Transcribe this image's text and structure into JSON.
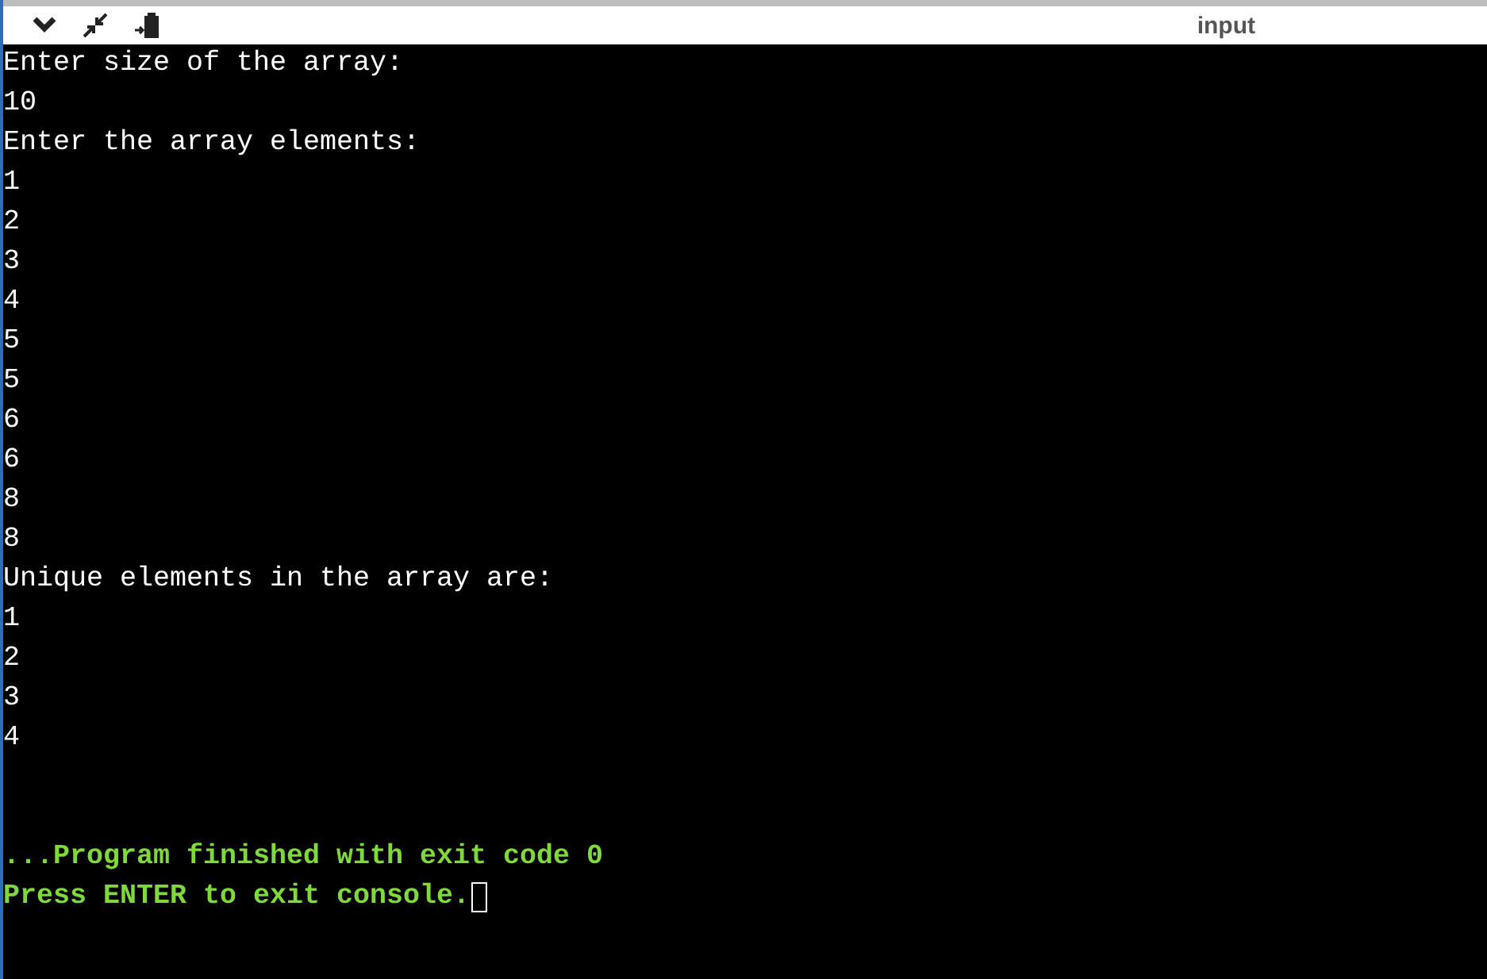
{
  "toolbar": {
    "panel_title": "input"
  },
  "console": {
    "lines": [
      "Enter size of the array:",
      "10",
      "Enter the array elements:",
      "1",
      "2",
      "3",
      "4",
      "5",
      "5",
      "6",
      "6",
      "8",
      "8",
      "Unique elements in the array are:",
      "1",
      "2",
      "3",
      "4"
    ],
    "exit_messages": [
      "...Program finished with exit code 0",
      "Press ENTER to exit console."
    ]
  }
}
